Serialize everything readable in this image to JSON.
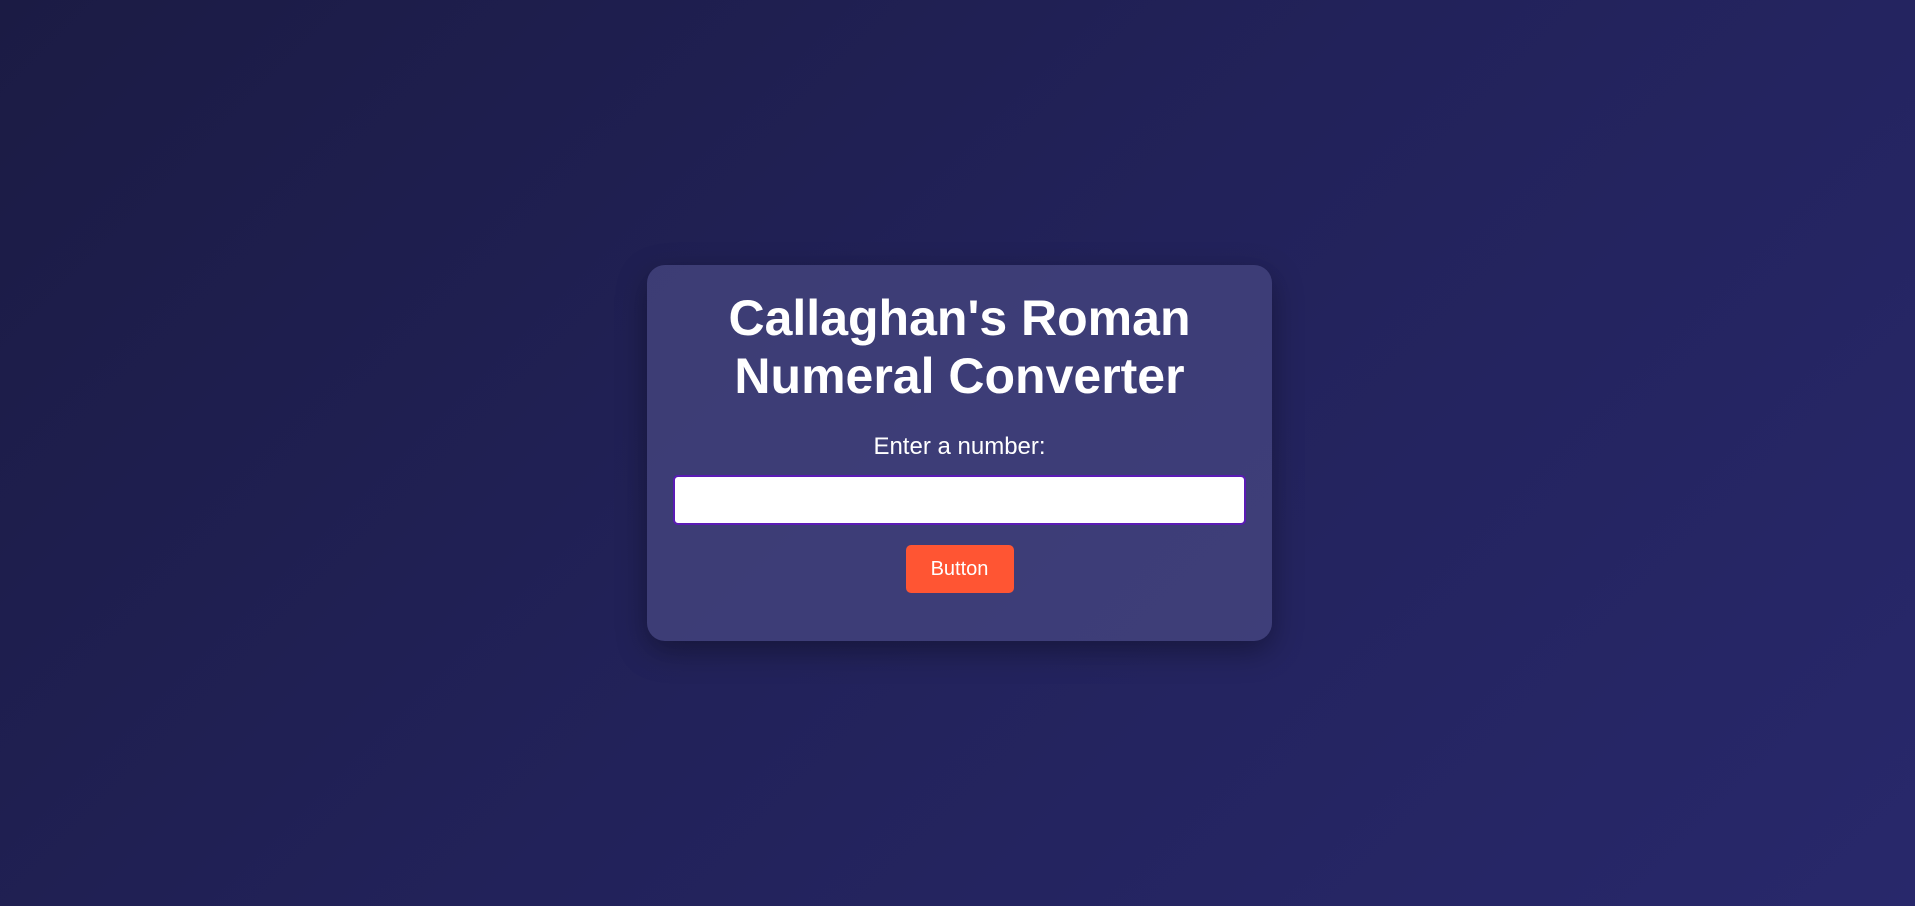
{
  "card": {
    "title_line1": "Callaghan's Roman",
    "title_line2": "Numeral Converter",
    "label": "Enter a number:",
    "input_value": "",
    "input_placeholder": "",
    "button_label": "Button"
  },
  "colors": {
    "button_bg": "#ff5533",
    "input_border": "#5a1bb5",
    "background_start": "#1b1b44",
    "background_end": "#28286b"
  }
}
